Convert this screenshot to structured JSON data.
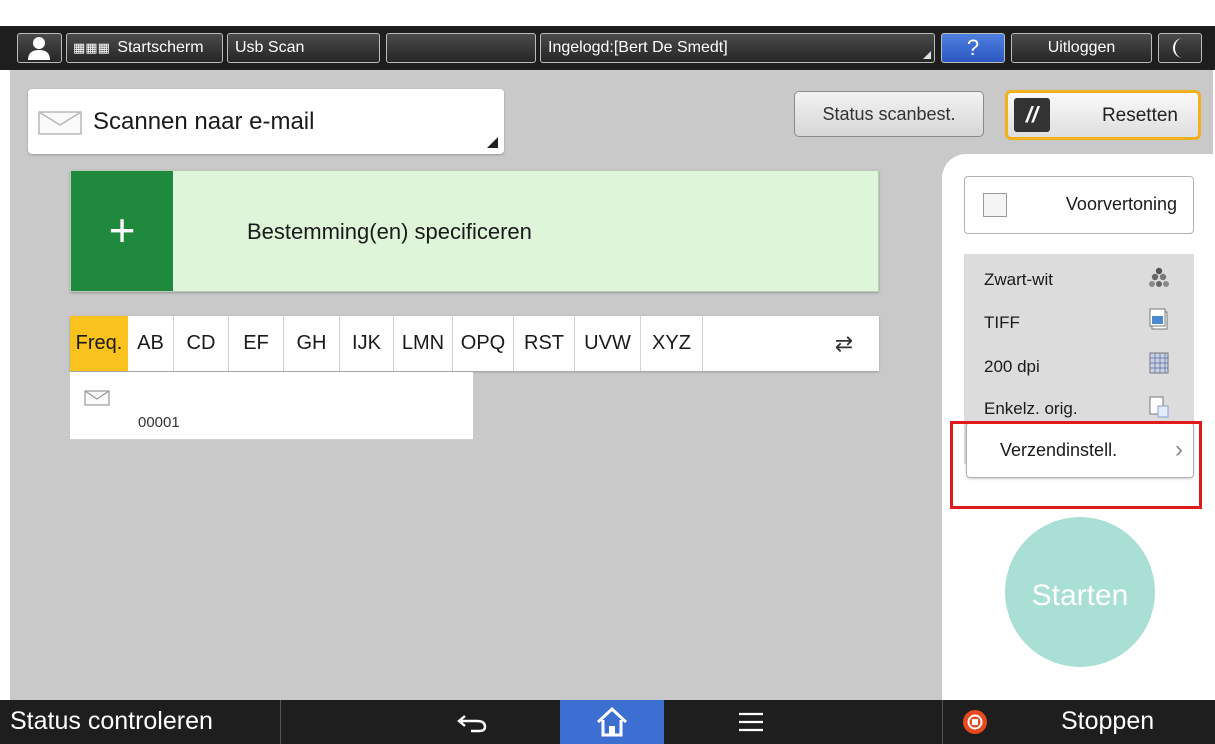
{
  "topbar": {
    "home_label": "Startscherm",
    "usb_label": "Usb Scan",
    "login_label": "Ingelogd:[Bert De Smedt]",
    "help_label": "?",
    "logout_label": "Uitloggen"
  },
  "scan": {
    "mode_label": "Scannen naar e-mail",
    "status_button": "Status scanbest.",
    "reset_button": "Resetten"
  },
  "destination": {
    "label": "Bestemming(en) specificeren",
    "plus": "+"
  },
  "tabs": [
    "Freq.",
    "AB",
    "CD",
    "EF",
    "GH",
    "IJK",
    "LMN",
    "OPQ",
    "RST",
    "UVW",
    "XYZ"
  ],
  "address_book": {
    "entries": [
      {
        "number": "00001"
      }
    ]
  },
  "panel": {
    "preview_label": "Voorvertoning",
    "settings": [
      "Zwart-wit",
      "TIFF",
      "200 dpi",
      "Enkelz. orig."
    ],
    "send_settings": "Verzendinstell.",
    "start_button": "Starten"
  },
  "bottombar": {
    "status_label": "Status controleren",
    "stop_label": "Stoppen"
  },
  "colors": {
    "accent_yellow": "#f9c21d",
    "destination_green": "#1f8a3e",
    "start_teal": "#a9dfd5",
    "home_blue": "#3c6fd1",
    "highlight_red": "#e01a1a"
  }
}
